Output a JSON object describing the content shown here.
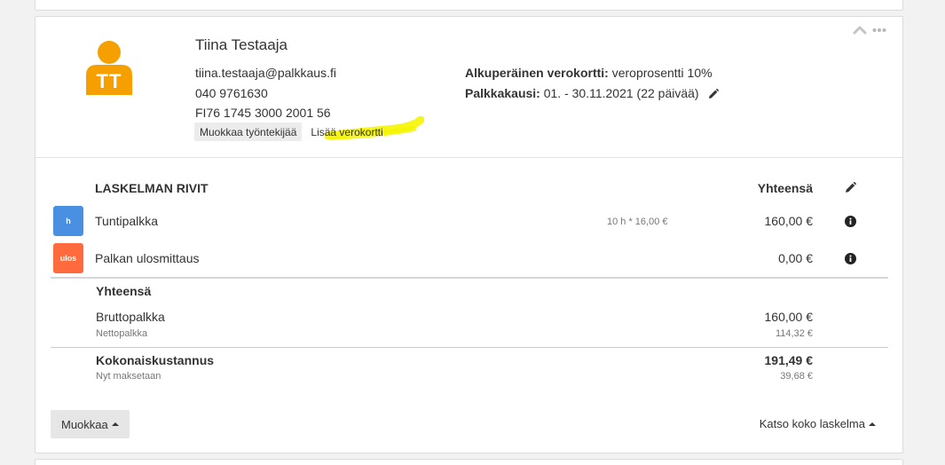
{
  "employee": {
    "initials": "TT",
    "name": "Tiina Testaaja",
    "email": "tiina.testaaja@palkkaus.fi",
    "phone": "040 9761630",
    "iban": "FI76 1745 3000 2001 56",
    "edit_employee_label": "Muokkaa työntekijää",
    "add_taxcard_label": "Lisää verokortti",
    "avatar_color": "#f5a000"
  },
  "tax": {
    "original_taxcard_label": "Alkuperäinen verokortti:",
    "original_taxcard_value": "veroprosentti 10%",
    "pay_period_label": "Palkkakausi:",
    "pay_period_value": "01. - 30.11.2021 (22 päivää)"
  },
  "rows": {
    "title": "LASKELMAN RIVIT",
    "total_header": "Yhteensä",
    "items": [
      {
        "icon_text": "h",
        "icon_color": "#4a90e2",
        "label": "Tuntipalkka",
        "qty": "10 h * 16,00 €",
        "amount": "160,00 €"
      },
      {
        "icon_text": "ulos",
        "icon_color": "#ff6b3d",
        "label": "Palkan ulosmittaus",
        "qty": "",
        "amount": "0,00 €"
      }
    ]
  },
  "summary": {
    "title": "Yhteensä",
    "gross_label": "Bruttopalkka",
    "gross_value": "160,00 €",
    "net_label": "Nettopalkka",
    "net_value": "114,32 €",
    "total_cost_label": "Kokonaiskustannus",
    "total_cost_value": "191,49 €",
    "paid_now_label": "Nyt maksetaan",
    "paid_now_value": "39,68 €"
  },
  "footer": {
    "edit_label": "Muokkaa",
    "view_full_label": "Katso koko laskelma"
  },
  "highlight_color": "#f5f500"
}
